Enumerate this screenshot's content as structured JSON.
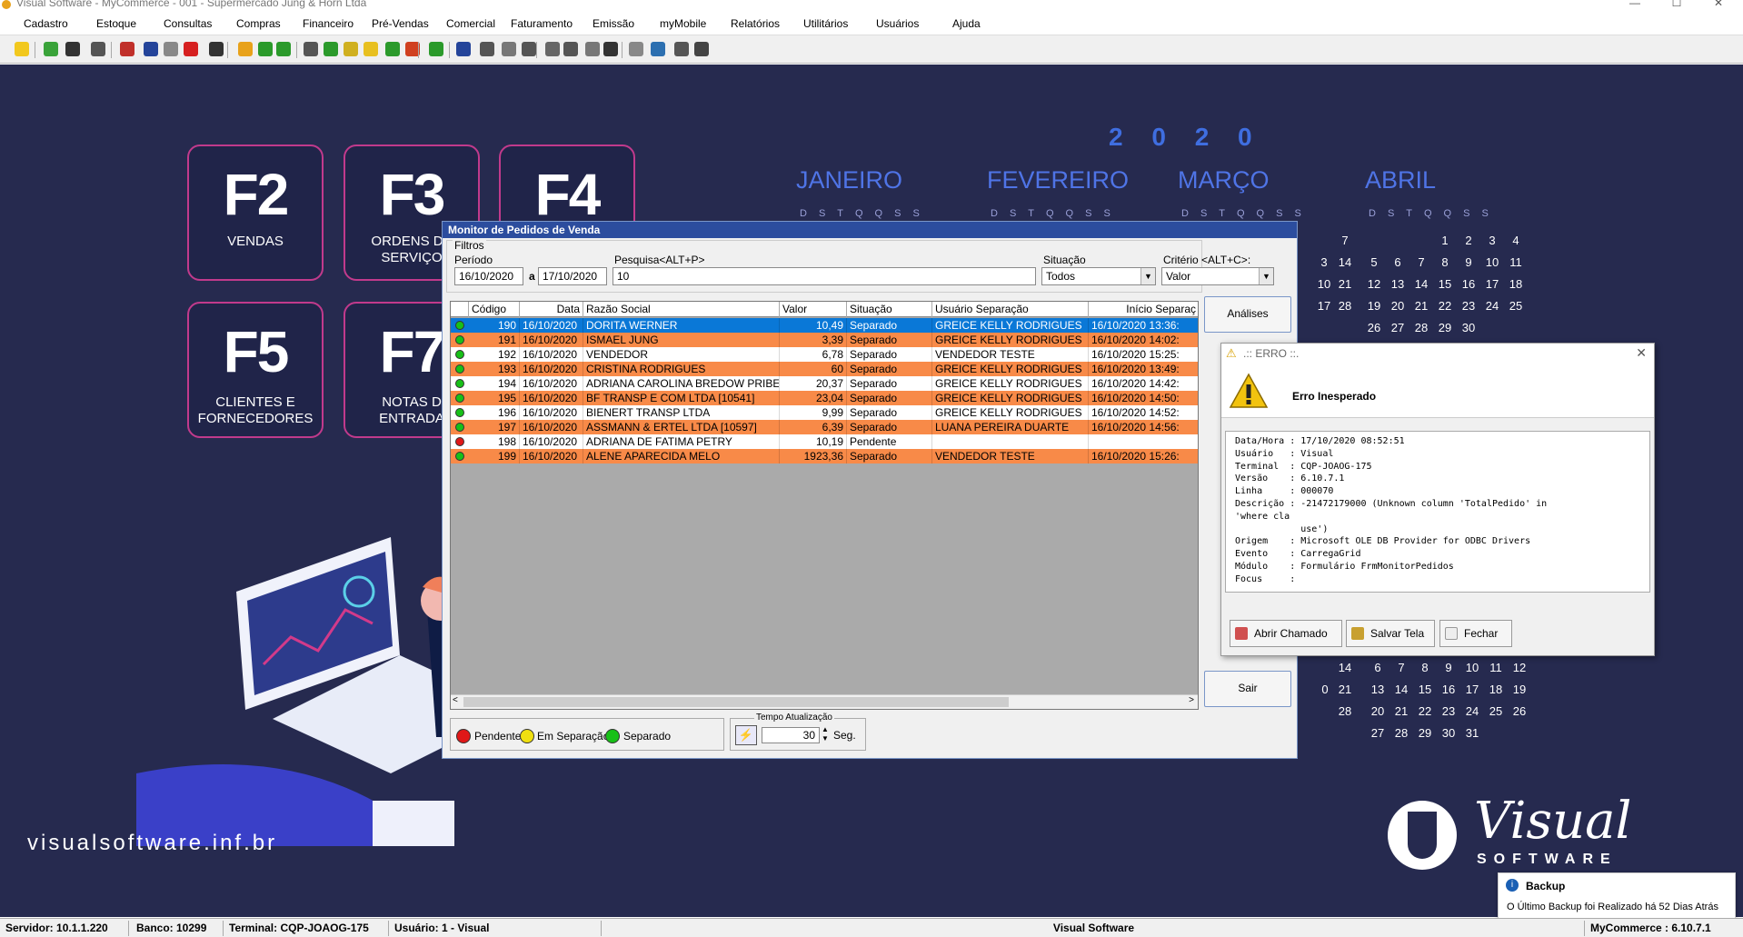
{
  "window": {
    "title": "Visual Software - MyCommerce - 001 - Supermercado Jung & Horn Ltda",
    "minimize_glyph": "—",
    "maximize_glyph": "☐",
    "close_glyph": "✕"
  },
  "menu": [
    "Cadastro",
    "Estoque",
    "Consultas",
    "Compras",
    "Financeiro",
    "Pré-Vendas",
    "Comercial",
    "Faturamento",
    "Emissão",
    "myMobile",
    "Relatórios",
    "Utilitários",
    "Usuários",
    "Ajuda"
  ],
  "toolbar_colors": [
    "#f2c81e",
    "#3aa33a",
    "#333",
    "#555",
    "#c0302a",
    "#24449a",
    "#888",
    "#d62020",
    "#333",
    "#e8a21b",
    "#2b9a2b",
    "#2b9a2b",
    "#555",
    "#2b9a2b",
    "#d0b020",
    "#e8c020",
    "#2b9a2b",
    "#d04020",
    "#2b9a2b",
    "#24449a",
    "#555",
    "#777",
    "#555",
    "#666",
    "#555",
    "#777",
    "#333",
    "#888",
    "#2c6fb0",
    "#555",
    "#444"
  ],
  "function_keys": [
    {
      "key": "F2",
      "desc1": "VENDAS",
      "desc2": ""
    },
    {
      "key": "F3",
      "desc1": "ORDENS DE",
      "desc2": "SERVIÇO"
    },
    {
      "key": "F4",
      "desc1": "",
      "desc2": ""
    },
    {
      "key": "F5",
      "desc1": "CLIENTES E",
      "desc2": "FORNECEDORES"
    },
    {
      "key": "F7",
      "desc1": "NOTAS D",
      "desc2": "ENTRADA"
    }
  ],
  "calendar": {
    "year": "2 0 2 0",
    "months": [
      "JANEIRO",
      "FEVEREIRO",
      "MARÇO",
      "ABRIL"
    ],
    "dow": "DSTQQSS",
    "april_weeks": [
      [
        "",
        "",
        "1",
        "2",
        "3",
        "4"
      ],
      [
        "5",
        "6",
        "7",
        "8",
        "9",
        "10",
        "11"
      ],
      [
        "12",
        "13",
        "14",
        "15",
        "16",
        "17",
        "18"
      ],
      [
        "19",
        "20",
        "21",
        "22",
        "23",
        "24",
        "25"
      ],
      [
        "26",
        "27",
        "28",
        "29",
        "30"
      ]
    ],
    "march_partial": [
      "7",
      "14",
      "21",
      "28"
    ],
    "march_partial_prev": [
      "3",
      "10",
      "17"
    ],
    "lower_weeks": [
      [
        "6",
        "7",
        "8",
        "9",
        "10",
        "11",
        "12"
      ],
      [
        "13",
        "14",
        "15",
        "16",
        "17",
        "18",
        "19"
      ],
      [
        "20",
        "21",
        "22",
        "23",
        "24",
        "25",
        "26"
      ],
      [
        "27",
        "28",
        "29",
        "30",
        "31"
      ]
    ],
    "lower_partial": [
      "14",
      "21",
      "28"
    ],
    "lower_partial_prev": [
      "0"
    ]
  },
  "site_url": "visualsoftware.inf.br",
  "logo": {
    "name": "Visual",
    "sub": "SOFTWARE"
  },
  "monitor": {
    "title": "Monitor de Pedidos de Venda",
    "filtros_label": "Filtros",
    "periodo_label": "Período",
    "date_from": "16/10/2020",
    "a_label": "a",
    "date_to": "17/10/2020",
    "pesquisa_label": "Pesquisa<ALT+P>",
    "pesquisa_value": "10",
    "situacao_label": "Situação",
    "situacao_value": "Todos",
    "criterio_label": "Critério <ALT+C>:",
    "criterio_value": "Valor",
    "analises_button": "Análises",
    "sair_button": "Sair",
    "columns": [
      "Código",
      "Data",
      "Razão Social",
      "Valor",
      "Situação",
      "Usuário Separação",
      "Início Separaç"
    ],
    "rows": [
      {
        "status": "green",
        "codigo": "190",
        "data": "16/10/2020",
        "razao": "DORITA WERNER",
        "valor": "10,49",
        "situacao": "Separado",
        "usuario": "GREICE KELLY RODRIGUES",
        "inicio": "16/10/2020 13:36:",
        "style": "selected"
      },
      {
        "status": "green",
        "codigo": "191",
        "data": "16/10/2020",
        "razao": "ISMAEL JUNG",
        "valor": "3,39",
        "situacao": "Separado",
        "usuario": "GREICE KELLY RODRIGUES",
        "inicio": "16/10/2020 14:02:",
        "style": "orange"
      },
      {
        "status": "green",
        "codigo": "192",
        "data": "16/10/2020",
        "razao": "VENDEDOR",
        "valor": "6,78",
        "situacao": "Separado",
        "usuario": "VENDEDOR TESTE",
        "inicio": "16/10/2020 15:25:",
        "style": "white"
      },
      {
        "status": "green",
        "codigo": "193",
        "data": "16/10/2020",
        "razao": "CRISTINA RODRIGUES",
        "valor": "60",
        "situacao": "Separado",
        "usuario": "GREICE KELLY RODRIGUES",
        "inicio": "16/10/2020 13:49:",
        "style": "orange"
      },
      {
        "status": "green",
        "codigo": "194",
        "data": "16/10/2020",
        "razao": "ADRIANA CAROLINA BREDOW PRIBE",
        "valor": "20,37",
        "situacao": "Separado",
        "usuario": "GREICE KELLY RODRIGUES",
        "inicio": "16/10/2020 14:42:",
        "style": "white"
      },
      {
        "status": "green",
        "codigo": "195",
        "data": "16/10/2020",
        "razao": "BF TRANSP E COM LTDA [10541]",
        "valor": "23,04",
        "situacao": "Separado",
        "usuario": "GREICE KELLY RODRIGUES",
        "inicio": "16/10/2020 14:50:",
        "style": "orange"
      },
      {
        "status": "green",
        "codigo": "196",
        "data": "16/10/2020",
        "razao": "BIENERT TRANSP LTDA",
        "valor": "9,99",
        "situacao": "Separado",
        "usuario": "GREICE KELLY RODRIGUES",
        "inicio": "16/10/2020 14:52:",
        "style": "white"
      },
      {
        "status": "green",
        "codigo": "197",
        "data": "16/10/2020",
        "razao": "ASSMANN & ERTEL LTDA [10597]",
        "valor": "6,39",
        "situacao": "Separado",
        "usuario": "LUANA PEREIRA DUARTE",
        "inicio": "16/10/2020 14:56:",
        "style": "orange"
      },
      {
        "status": "red",
        "codigo": "198",
        "data": "16/10/2020",
        "razao": "ADRIANA DE FATIMA PETRY",
        "valor": "10,19",
        "situacao": "Pendente",
        "usuario": "",
        "inicio": "",
        "style": "white"
      },
      {
        "status": "green",
        "codigo": "199",
        "data": "16/10/2020",
        "razao": "ALENE APARECIDA MELO",
        "valor": "1923,36",
        "situacao": "Separado",
        "usuario": "VENDEDOR TESTE",
        "inicio": "16/10/2020 15:26:",
        "style": "orange"
      }
    ],
    "legend": {
      "pendente": "Pendente",
      "em_separacao": "Em Separação",
      "separado": "Separado"
    },
    "tempo_label": "Tempo Atualização",
    "tempo_value": "30",
    "seg_label": "Seg."
  },
  "error": {
    "title": ".:: ERRO ::.",
    "heading": "Erro Inesperado",
    "details": "Data/Hora : 17/10/2020 08:52:51\nUsuário   : Visual\nTerminal  : CQP-JOAOG-175\nVersão    : 6.10.7.1\nLinha     : 000070\nDescrição : -21472179000 (Unknown column 'TotalPedido' in\n'where cla\n            use')\nOrigem    : Microsoft OLE DB Provider for ODBC Drivers\nEvento    : CarregaGrid\nMódulo    : Formulário FrmMonitorPedidos\nFocus     :",
    "abrir_chamado": "Abrir Chamado",
    "salvar_tela": "Salvar Tela",
    "fechar": "Fechar"
  },
  "notification": {
    "title": "Backup",
    "message": "O Último Backup foi Realizado há 52 Dias Atrás"
  },
  "status": {
    "servidor": "Servidor: 10.1.1.220",
    "banco": "Banco: 10299",
    "terminal": "Terminal: CQP-JOAOG-175",
    "usuario": "Usuário: 1 - Visual",
    "empresa": "Visual Software",
    "versao": "MyCommerce : 6.10.7.1"
  },
  "colors": {
    "desktop_bg": "#262a4f",
    "accent_magenta": "#c13a8c",
    "row_orange": "#f88a48",
    "row_selected": "#0a78d7",
    "status_green": "#18c018",
    "status_red": "#e01818",
    "status_yellow": "#f0e010"
  }
}
